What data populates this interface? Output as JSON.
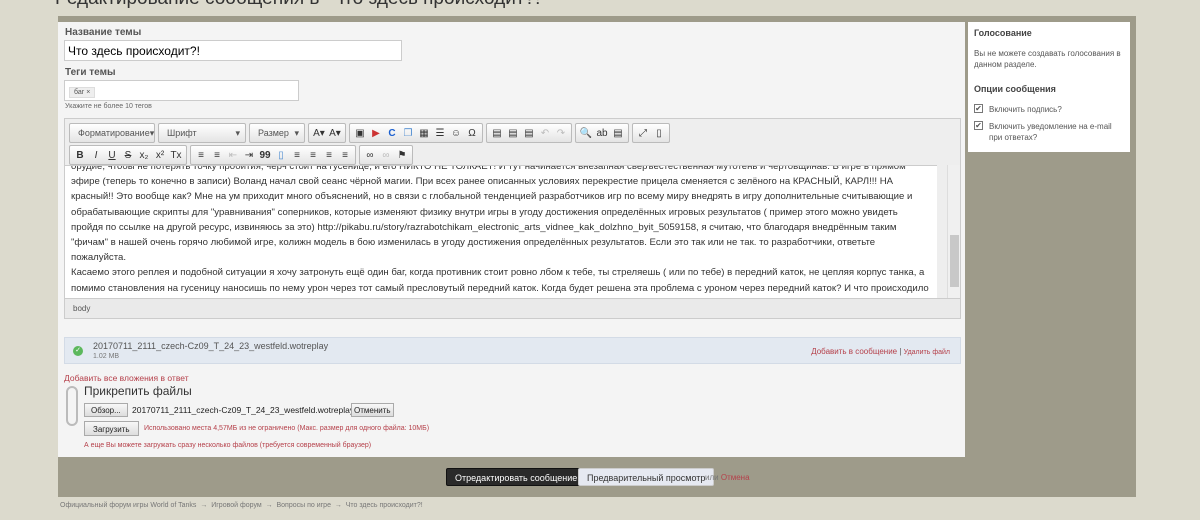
{
  "page_title": "Редактирование сообщения в \"Что здесь происходит?!\"",
  "form": {
    "title_label": "Название темы",
    "title_value": "Что здесь происходит?!",
    "tags_label": "Теги темы",
    "tags": [
      "баг"
    ],
    "tag_remove": "×",
    "tags_hint": "Укажите не более 10 тегов"
  },
  "toolbar": {
    "format": "Форматирование",
    "font": "Шрифт",
    "size": "Размер",
    "row1": [
      "A▾",
      "A▾",
      "▣",
      "▶",
      "C",
      "❐",
      "▦",
      "☰",
      "☺",
      "Ω",
      "▤",
      "▤",
      "▤",
      "↶",
      "↷",
      "🔍",
      "ab",
      "▤",
      "⤢",
      "▯"
    ],
    "row2": [
      "B",
      "I",
      "U",
      "S",
      "x₂",
      "x²",
      "Tx",
      "≡",
      "≡",
      "⇤",
      "⇥",
      "99",
      "▯",
      "≡",
      "≡",
      "≡",
      "≡",
      "∞",
      "∞",
      "⚑"
    ]
  },
  "editor": {
    "paragraphs": [
      "орудие, чтобы не потерять точку пробития, черч стоит на гусенице, и его НИКТО НЕ ТОЛКАЕТ! И тут начинается внезапная сверъестественная мутотень и чертовщинав.  В игре в прямом эфире (теперь то конечно в записи) Воланд начал свой сеанс чёрной магии. При всех ранее описанных условиях перекрестие прицела сменяется с зелёного на КРАСНЫЙ, КАРЛ!!! НА красный!! Это вообще как? Мне на ум приходит много объяснений, но в связи с глобальной тенденцией разработчиков игр по всему миру внедрять в игру дополнительные считывающие и обрабатывающие скрипты для \"уравнивания\" соперников, которые изменяют физику внутри игры в угоду достижения определённых игровых результатов ( пример этого можно увидеть пройдя по ссылке на другой ресурс, извиняюсь за это)  http://pikabu.ru/story/razrabotchikam_electronic_arts_vidnee_kak_dolzhno_byit_5059158, я считаю, что благодаря внедрённым таким \"фичам\" в нашей очень горячо любимой игре, колижн модель в бою изменилась в угоду достижения определённых результатов. Если  это так или не так. то разработчики, ответьте пожалуйста.",
      "   Касаемо этого реплея и подобной ситуации я хочу затронуть  ещё один баг, когда  противник стоит ровно лбом к тебе, ты стреляешь ( или по тебе) в передний каток, не цепляя корпус танка, а помимо становления на гусеницу наносишь по нему урон через тот самый пресловутый передний каток. Когда будет решена эта проблема с уроном через передний каток? И что происходило ч гусеницей Черча в том бою?"
    ],
    "status": "body"
  },
  "attachment": {
    "filename": "20170711_2111_czech-Cz09_T_24_23_westfeld.wotreplay",
    "size": "1.02 MB",
    "insert": "Добавить в сообщение",
    "sep": "|",
    "delete": "Удалить файл"
  },
  "add_all": "Добавить все вложения в ответ",
  "upload": {
    "title": "Прикрепить файлы",
    "browse": "Обзор...",
    "file": "20170711_2111_czech-Cz09_T_24_23_westfeld.wotreplay",
    "cancel": "Отменить",
    "upload": "Загрузить",
    "usage": "Использовано места 4,57МБ из не ограничено (Макс. размер для одного файла: 10МБ)",
    "multi": "А еще Вы можете загружать сразу несколько файлов (требуется современный браузер)"
  },
  "sidebar": {
    "poll_title": "Голосование",
    "poll_text": "Вы не можете создавать голосования в данном разделе.",
    "options_title": "Опции сообщения",
    "options": [
      {
        "label": "Включить подпись?",
        "checked": true
      },
      {
        "label": "Включить уведомление на e-mail при ответах?",
        "checked": true
      }
    ]
  },
  "actions": {
    "submit": "Отредактировать сообщение",
    "preview": "Предварительный просмотр",
    "or": "или",
    "cancel": "Отмена"
  },
  "breadcrumbs": [
    "Официальный форум игры World of Tanks",
    "Игровой форум",
    "Вопросы по игре",
    "Что здесь происходит?!"
  ],
  "crumb_sep": "→"
}
